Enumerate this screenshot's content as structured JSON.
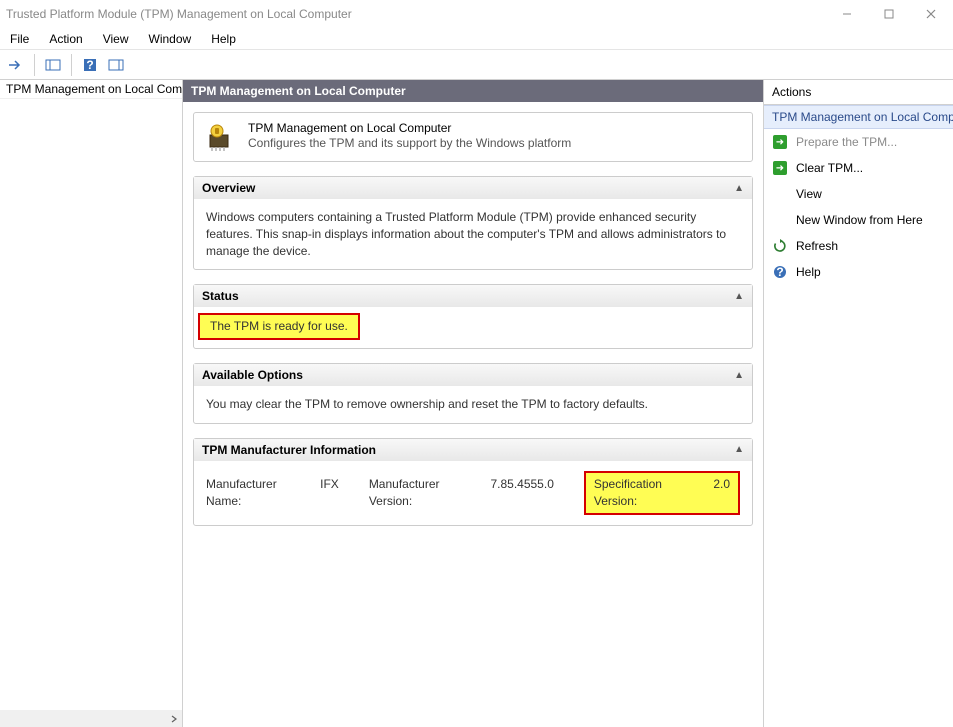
{
  "window": {
    "title": "Trusted Platform Module (TPM) Management on Local Computer"
  },
  "menu": {
    "file": "File",
    "action": "Action",
    "view": "View",
    "window": "Window",
    "help": "Help"
  },
  "tree": {
    "root": "TPM Management on Local Comp"
  },
  "center": {
    "header": "TPM Management on Local Computer",
    "intro_line1": "TPM Management on Local Computer",
    "intro_line2": "Configures the TPM and its support by the Windows platform",
    "overview": {
      "title": "Overview",
      "body": "Windows computers containing a Trusted Platform Module (TPM) provide enhanced security features. This snap-in displays information about the computer's TPM and allows administrators to manage the device."
    },
    "status": {
      "title": "Status",
      "message": "The TPM is ready for use."
    },
    "options": {
      "title": "Available Options",
      "body": "You may clear the TPM to remove ownership and reset the TPM to factory defaults."
    },
    "mfr": {
      "title": "TPM Manufacturer Information",
      "name_label": "Manufacturer Name:",
      "name_value": "IFX",
      "ver_label": "Manufacturer Version:",
      "ver_value": "7.85.4555.0",
      "spec_label": "Specification Version:",
      "spec_value": "2.0"
    }
  },
  "actions": {
    "title": "Actions",
    "subtitle": "TPM Management on Local Compu",
    "items": {
      "prepare": "Prepare the TPM...",
      "clear": "Clear TPM...",
      "view": "View",
      "newwin": "New Window from Here",
      "refresh": "Refresh",
      "help": "Help"
    }
  }
}
